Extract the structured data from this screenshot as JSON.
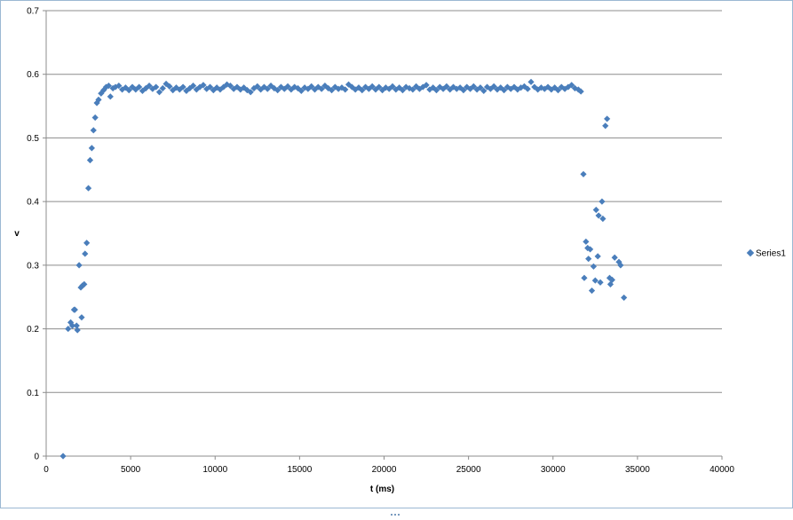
{
  "chart_data": {
    "type": "scatter",
    "title": "",
    "xlabel": "t (ms)",
    "ylabel": "v",
    "xlim": [
      0,
      40000
    ],
    "ylim": [
      0,
      0.7
    ],
    "xticks": [
      "0",
      "5000",
      "10000",
      "15000",
      "20000",
      "25000",
      "30000",
      "35000",
      "40000"
    ],
    "yticks": [
      "0",
      "0.1",
      "0.2",
      "0.3",
      "0.4",
      "0.5",
      "0.6",
      "0.7"
    ],
    "grid": "horizontal",
    "legend_position": "right",
    "marker_color": "#4a7ebb",
    "series": [
      {
        "name": "Series1",
        "points": [
          [
            1000,
            0.0
          ],
          [
            1300,
            0.2
          ],
          [
            1450,
            0.21
          ],
          [
            1550,
            0.205
          ],
          [
            1650,
            0.23
          ],
          [
            1700,
            0.23
          ],
          [
            1800,
            0.205
          ],
          [
            1850,
            0.198
          ],
          [
            1950,
            0.3
          ],
          [
            2050,
            0.265
          ],
          [
            2100,
            0.218
          ],
          [
            2150,
            0.268
          ],
          [
            2250,
            0.27
          ],
          [
            2300,
            0.318
          ],
          [
            2400,
            0.335
          ],
          [
            2500,
            0.421
          ],
          [
            2600,
            0.465
          ],
          [
            2700,
            0.484
          ],
          [
            2800,
            0.512
          ],
          [
            2900,
            0.532
          ],
          [
            3000,
            0.555
          ],
          [
            3100,
            0.56
          ],
          [
            3250,
            0.57
          ],
          [
            3400,
            0.575
          ],
          [
            3550,
            0.58
          ],
          [
            3700,
            0.582
          ],
          [
            3800,
            0.565
          ],
          [
            3950,
            0.578
          ],
          [
            4100,
            0.58
          ],
          [
            4300,
            0.582
          ],
          [
            4500,
            0.576
          ],
          [
            4700,
            0.579
          ],
          [
            4900,
            0.575
          ],
          [
            5100,
            0.58
          ],
          [
            5300,
            0.576
          ],
          [
            5500,
            0.58
          ],
          [
            5700,
            0.574
          ],
          [
            5900,
            0.578
          ],
          [
            6100,
            0.582
          ],
          [
            6300,
            0.577
          ],
          [
            6500,
            0.58
          ],
          [
            6700,
            0.572
          ],
          [
            6900,
            0.578
          ],
          [
            7100,
            0.585
          ],
          [
            7300,
            0.581
          ],
          [
            7500,
            0.575
          ],
          [
            7700,
            0.579
          ],
          [
            7900,
            0.576
          ],
          [
            8100,
            0.58
          ],
          [
            8300,
            0.574
          ],
          [
            8500,
            0.578
          ],
          [
            8700,
            0.582
          ],
          [
            8900,
            0.576
          ],
          [
            9100,
            0.58
          ],
          [
            9300,
            0.583
          ],
          [
            9500,
            0.577
          ],
          [
            9700,
            0.58
          ],
          [
            9900,
            0.575
          ],
          [
            10100,
            0.579
          ],
          [
            10300,
            0.576
          ],
          [
            10500,
            0.58
          ],
          [
            10700,
            0.584
          ],
          [
            10900,
            0.582
          ],
          [
            11100,
            0.577
          ],
          [
            11300,
            0.58
          ],
          [
            11500,
            0.576
          ],
          [
            11700,
            0.579
          ],
          [
            11900,
            0.575
          ],
          [
            12100,
            0.572
          ],
          [
            12300,
            0.578
          ],
          [
            12500,
            0.581
          ],
          [
            12700,
            0.576
          ],
          [
            12900,
            0.58
          ],
          [
            13100,
            0.577
          ],
          [
            13300,
            0.582
          ],
          [
            13500,
            0.578
          ],
          [
            13700,
            0.575
          ],
          [
            13900,
            0.58
          ],
          [
            14100,
            0.577
          ],
          [
            14300,
            0.581
          ],
          [
            14500,
            0.576
          ],
          [
            14700,
            0.58
          ],
          [
            14900,
            0.578
          ],
          [
            15100,
            0.574
          ],
          [
            15300,
            0.579
          ],
          [
            15500,
            0.577
          ],
          [
            15700,
            0.581
          ],
          [
            15900,
            0.576
          ],
          [
            16100,
            0.58
          ],
          [
            16300,
            0.577
          ],
          [
            16500,
            0.582
          ],
          [
            16700,
            0.578
          ],
          [
            16900,
            0.575
          ],
          [
            17100,
            0.58
          ],
          [
            17300,
            0.577
          ],
          [
            17500,
            0.579
          ],
          [
            17700,
            0.576
          ],
          [
            17900,
            0.584
          ],
          [
            18100,
            0.58
          ],
          [
            18300,
            0.576
          ],
          [
            18500,
            0.579
          ],
          [
            18700,
            0.575
          ],
          [
            18900,
            0.58
          ],
          [
            19100,
            0.577
          ],
          [
            19300,
            0.581
          ],
          [
            19500,
            0.576
          ],
          [
            19700,
            0.58
          ],
          [
            19900,
            0.575
          ],
          [
            20100,
            0.579
          ],
          [
            20300,
            0.577
          ],
          [
            20500,
            0.581
          ],
          [
            20700,
            0.576
          ],
          [
            20900,
            0.579
          ],
          [
            21100,
            0.575
          ],
          [
            21300,
            0.58
          ],
          [
            21500,
            0.578
          ],
          [
            21700,
            0.576
          ],
          [
            21900,
            0.581
          ],
          [
            22100,
            0.577
          ],
          [
            22300,
            0.58
          ],
          [
            22500,
            0.583
          ],
          [
            22700,
            0.576
          ],
          [
            22900,
            0.579
          ],
          [
            23100,
            0.575
          ],
          [
            23300,
            0.58
          ],
          [
            23500,
            0.577
          ],
          [
            23700,
            0.581
          ],
          [
            23900,
            0.576
          ],
          [
            24100,
            0.58
          ],
          [
            24300,
            0.577
          ],
          [
            24500,
            0.579
          ],
          [
            24700,
            0.575
          ],
          [
            24900,
            0.58
          ],
          [
            25100,
            0.577
          ],
          [
            25300,
            0.581
          ],
          [
            25500,
            0.576
          ],
          [
            25700,
            0.579
          ],
          [
            25900,
            0.574
          ],
          [
            26100,
            0.58
          ],
          [
            26300,
            0.577
          ],
          [
            26500,
            0.581
          ],
          [
            26700,
            0.576
          ],
          [
            26900,
            0.579
          ],
          [
            27100,
            0.575
          ],
          [
            27300,
            0.58
          ],
          [
            27500,
            0.577
          ],
          [
            27700,
            0.58
          ],
          [
            27900,
            0.576
          ],
          [
            28100,
            0.579
          ],
          [
            28300,
            0.581
          ],
          [
            28500,
            0.577
          ],
          [
            28700,
            0.588
          ],
          [
            28900,
            0.58
          ],
          [
            29100,
            0.576
          ],
          [
            29300,
            0.579
          ],
          [
            29500,
            0.577
          ],
          [
            29700,
            0.58
          ],
          [
            29900,
            0.576
          ],
          [
            30100,
            0.579
          ],
          [
            30300,
            0.575
          ],
          [
            30500,
            0.58
          ],
          [
            30700,
            0.577
          ],
          [
            30900,
            0.58
          ],
          [
            31100,
            0.583
          ],
          [
            31300,
            0.578
          ],
          [
            31500,
            0.576
          ],
          [
            31650,
            0.573
          ],
          [
            31800,
            0.443
          ],
          [
            31850,
            0.28
          ],
          [
            31950,
            0.337
          ],
          [
            32050,
            0.327
          ],
          [
            32100,
            0.31
          ],
          [
            32200,
            0.325
          ],
          [
            32300,
            0.26
          ],
          [
            32400,
            0.298
          ],
          [
            32500,
            0.276
          ],
          [
            32550,
            0.387
          ],
          [
            32650,
            0.314
          ],
          [
            32700,
            0.378
          ],
          [
            32800,
            0.273
          ],
          [
            32900,
            0.4
          ],
          [
            32950,
            0.373
          ],
          [
            33100,
            0.519
          ],
          [
            33200,
            0.53
          ],
          [
            33350,
            0.28
          ],
          [
            33400,
            0.27
          ],
          [
            33500,
            0.277
          ],
          [
            33650,
            0.312
          ],
          [
            33900,
            0.305
          ],
          [
            34000,
            0.3
          ],
          [
            34200,
            0.249
          ]
        ]
      }
    ]
  }
}
